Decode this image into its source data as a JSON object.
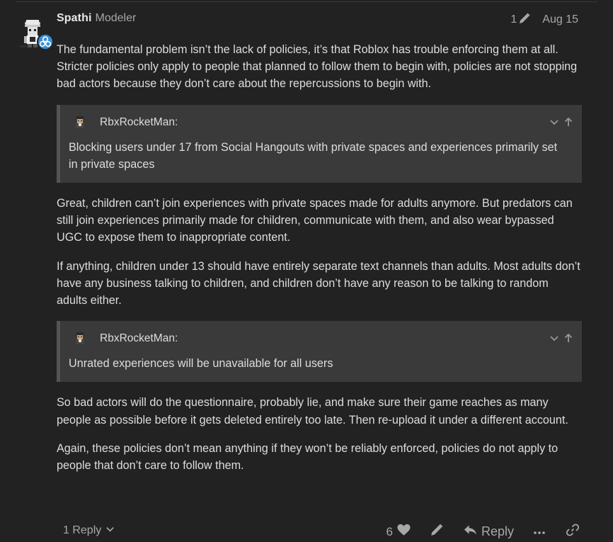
{
  "post": {
    "username": "Spathi",
    "user_title": "Modeler",
    "edit_count": "1",
    "date": "Aug 15",
    "paragraphs": [
      "The fundamental problem isn’t the lack of policies, it’s that Roblox has trouble enforcing them at all. Stricter policies only apply to people that planned to follow them to begin with, policies are not stopping bad actors because they don’t care about the repercussions to begin with.",
      "Great, children can’t join experiences with private spaces made for adults anymore. But predators can still join experiences primarily made for children, communicate with them, and also wear bypassed UGC to expose them to inappropriate content.",
      "If anything, children under 13 should have entirely separate text channels than adults. Most adults don’t have any business talking to children, and children don’t have any reason to be talking to random adults either.",
      "So bad actors will do the questionnaire, probably lie, and make sure their game reaches as many people as possible before it gets deleted entirely too late. Then re-upload it under a different account.",
      "Again, these policies don’t mean anything if they won’t be reliably enforced, policies do not apply to people that don’t care to follow them."
    ],
    "quotes": [
      {
        "author": "RbxRocketMan:",
        "text": "Blocking users under 17 from Social Hangouts with private spaces and experiences primarily set in private spaces"
      },
      {
        "author": "RbxRocketMan:",
        "text": "Unrated experiences will be unavailable for all users"
      }
    ]
  },
  "footer": {
    "replies_label": "1 Reply",
    "like_count": "6",
    "reply_label": "Reply"
  },
  "icons": {
    "edit": "pencil-icon",
    "like": "heart-icon",
    "reply": "reply-arrow-icon",
    "more": "ellipsis-icon",
    "share": "link-icon",
    "expand": "chevron-down-icon",
    "jump": "arrow-up-icon"
  },
  "colors": {
    "background": "#222222",
    "quote_background": "#3a3a3a",
    "text": "#dddddd",
    "muted": "#a8a8a8",
    "badge": "#3a8fd8"
  }
}
